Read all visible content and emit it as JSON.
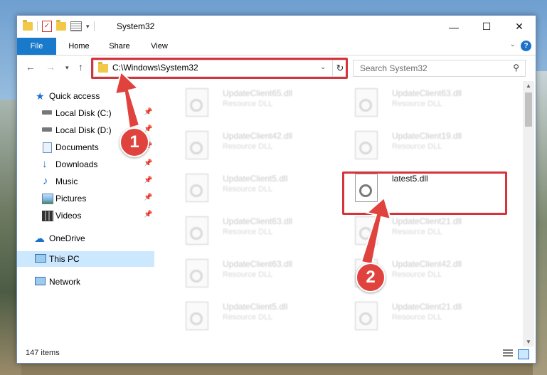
{
  "window": {
    "title": "System32",
    "controls": {
      "minimize": "—",
      "maximize": "☐",
      "close": "✕"
    }
  },
  "ribbon": {
    "tabs": [
      {
        "label": "File"
      },
      {
        "label": "Home"
      },
      {
        "label": "Share"
      },
      {
        "label": "View"
      }
    ],
    "help": "?"
  },
  "address": {
    "path": "C:\\Windows\\System32",
    "search_placeholder": "Search System32"
  },
  "sidebar": {
    "quick_access": "Quick access",
    "items": [
      {
        "label": "Local Disk (C:)"
      },
      {
        "label": "Local Disk (D:)"
      },
      {
        "label": "Documents"
      },
      {
        "label": "Downloads"
      },
      {
        "label": "Music"
      },
      {
        "label": "Pictures"
      },
      {
        "label": "Videos"
      }
    ],
    "onedrive": "OneDrive",
    "this_pc": "This PC",
    "network": "Network"
  },
  "files": [
    {
      "name": "UpdateClient65.dll",
      "type": "Resource DLL"
    },
    {
      "name": "UpdateClient63.dll",
      "type": "Resource DLL"
    },
    {
      "name": "UpdateClient42.dll",
      "type": "Resource DLL"
    },
    {
      "name": "UpdateClient19.dll",
      "type": "Resource DLL"
    },
    {
      "name": "UpdateClient5.dll",
      "type": "Resource DLL"
    },
    {
      "name": "latest5.dll",
      "type": ""
    },
    {
      "name": "UpdateClient63.dll",
      "type": "Resource DLL"
    },
    {
      "name": "UpdateClient21.dll",
      "type": "Resource DLL"
    },
    {
      "name": "UpdateClient63.dll",
      "type": "Resource DLL"
    },
    {
      "name": "UpdateClient42.dll",
      "type": "Resource DLL"
    },
    {
      "name": "UpdateClient5.dll",
      "type": "Resource DLL"
    },
    {
      "name": "UpdateClient21.dll",
      "type": "Resource DLL"
    }
  ],
  "status": {
    "count": "147 items"
  },
  "annotations": {
    "badge1": "1",
    "badge2": "2"
  },
  "colors": {
    "highlight": "#d6333a",
    "file_tab": "#1979ca",
    "badge": "#e0433d"
  }
}
